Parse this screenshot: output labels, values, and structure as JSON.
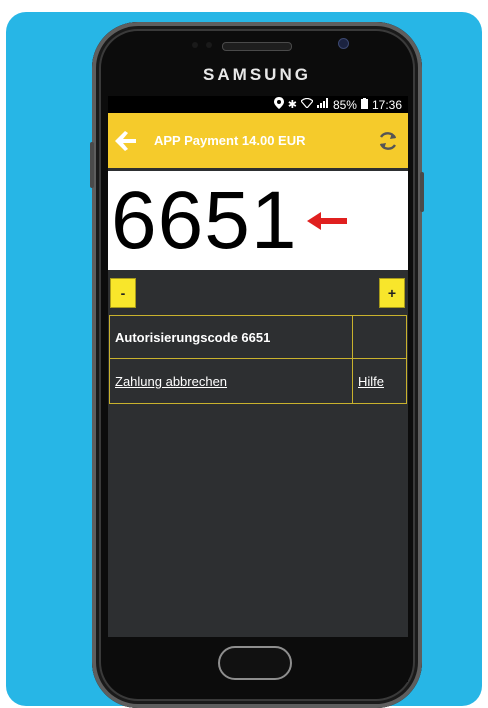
{
  "device": {
    "brand": "SAMSUNG"
  },
  "status_bar": {
    "battery": "85%",
    "time": "17:36"
  },
  "app_bar": {
    "title": "APP Payment 14.00 EUR",
    "icons": {
      "back": "arrow-left-icon",
      "refresh": "refresh-icon"
    }
  },
  "code_display": {
    "code": "6651",
    "indicator_icon": "red-arrow-left-icon"
  },
  "stepper": {
    "decrement_label": "-",
    "increment_label": "+"
  },
  "table": {
    "rows": [
      {
        "cells": [
          "Autorisierungscode 6651",
          ""
        ]
      },
      {
        "cells": [
          "Zahlung abbrechen",
          "Hilfe"
        ]
      }
    ]
  },
  "colors": {
    "background": "#27b6e6",
    "app_bar": "#f5cb2b",
    "screen_bg": "#2d2f31",
    "accent_red": "#e0201f",
    "button_yellow": "#f8e62b"
  }
}
